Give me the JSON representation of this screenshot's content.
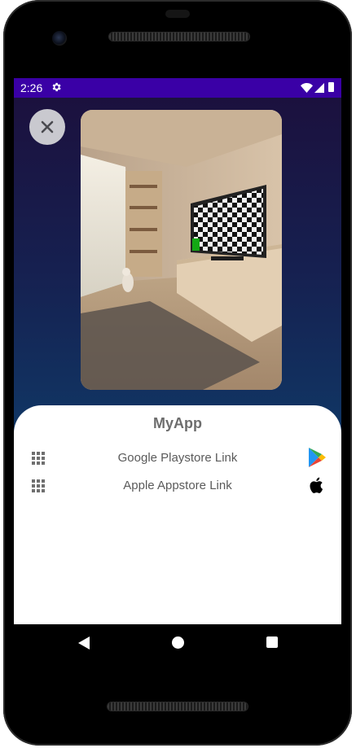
{
  "status_bar": {
    "time": "2:26",
    "settings_icon": "gear-icon",
    "wifi_icon": "wifi-icon",
    "signal_icon": "cell-signal-icon",
    "battery_icon": "battery-icon",
    "background": "#3a00a6"
  },
  "overlay": {
    "close_icon": "close-icon",
    "preview_image": "room-with-tv-preview"
  },
  "sheet": {
    "title": "MyApp",
    "items": [
      {
        "label": "Google Playstore Link",
        "handle_icon": "grid-icon",
        "store_icon": "google-play-icon"
      },
      {
        "label": "Apple Appstore Link",
        "handle_icon": "grid-icon",
        "store_icon": "apple-icon"
      }
    ]
  },
  "nav_bar": {
    "back_icon": "back-triangle-icon",
    "home_icon": "home-circle-icon",
    "recents_icon": "recents-square-icon"
  }
}
